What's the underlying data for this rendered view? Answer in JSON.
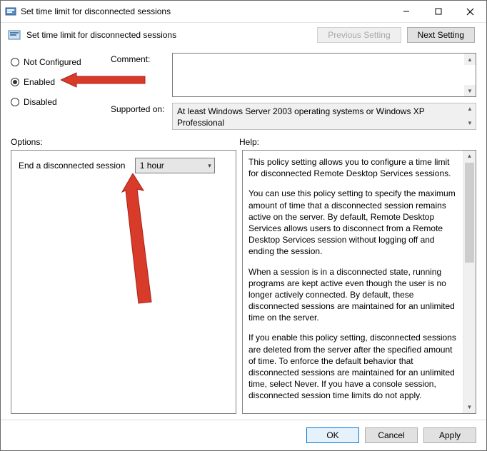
{
  "window": {
    "title": "Set time limit for disconnected sessions"
  },
  "header": {
    "title": "Set time limit for disconnected sessions",
    "prev": "Previous Setting",
    "next": "Next Setting"
  },
  "radios": {
    "not_configured": "Not Configured",
    "enabled": "Enabled",
    "disabled": "Disabled",
    "selected": "enabled"
  },
  "fields": {
    "comment_label": "Comment:",
    "supported_label": "Supported on:",
    "supported_text": "At least Windows Server 2003 operating systems or Windows XP Professional"
  },
  "sections": {
    "options": "Options:",
    "help": "Help:"
  },
  "options": {
    "end_label": "End a disconnected session",
    "end_value": "1 hour"
  },
  "help": {
    "p1": "This policy setting allows you to configure a time limit for disconnected Remote Desktop Services sessions.",
    "p2": "You can use this policy setting to specify the maximum amount of time that a disconnected session remains active on the server. By default, Remote Desktop Services allows users to disconnect from a Remote Desktop Services session without logging off and ending the session.",
    "p3": "When a session is in a disconnected state, running programs are kept active even though the user is no longer actively connected. By default, these disconnected sessions are maintained for an unlimited time on the server.",
    "p4": "If you enable this policy setting, disconnected sessions are deleted from the server after the specified amount of time. To enforce the default behavior that disconnected sessions are maintained for an unlimited time, select Never. If you have a console session, disconnected session time limits do not apply."
  },
  "footer": {
    "ok": "OK",
    "cancel": "Cancel",
    "apply": "Apply"
  },
  "colors": {
    "arrow": "#d83b2a",
    "primary": "#0078d7"
  }
}
